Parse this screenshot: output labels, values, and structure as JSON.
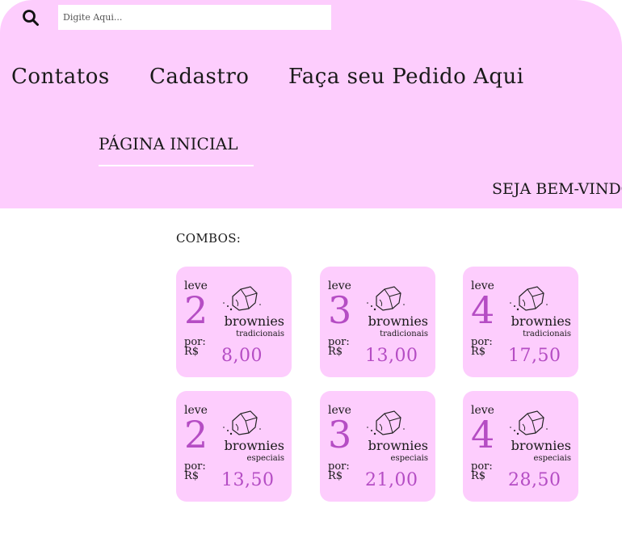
{
  "search": {
    "placeholder": "Digite Aqui..."
  },
  "nav": {
    "items": [
      {
        "label": "Contatos"
      },
      {
        "label": "Cadastro"
      },
      {
        "label": "Faça seu Pedido Aqui"
      }
    ],
    "home": "PÁGINA INICIAL"
  },
  "welcome": "SEJA BEM-VINDO",
  "combos": {
    "title": "COMBOS:",
    "cards": [
      {
        "leve": "leve",
        "qty": "2",
        "item": "brownies",
        "type": "tradicionais",
        "por": "por:",
        "currency": "R$",
        "price": "8,00"
      },
      {
        "leve": "leve",
        "qty": "3",
        "item": "brownies",
        "type": "tradicionais",
        "por": "por:",
        "currency": "R$",
        "price": "13,00"
      },
      {
        "leve": "leve",
        "qty": "4",
        "item": "brownies",
        "type": "tradicionais",
        "por": "por:",
        "currency": "R$",
        "price": "17,50"
      },
      {
        "leve": "leve",
        "qty": "2",
        "item": "brownies",
        "type": "especiais",
        "por": "por:",
        "currency": "R$",
        "price": "13,50"
      },
      {
        "leve": "leve",
        "qty": "3",
        "item": "brownies",
        "type": "especiais",
        "por": "por:",
        "currency": "R$",
        "price": "21,00"
      },
      {
        "leve": "leve",
        "qty": "4",
        "item": "brownies",
        "type": "especiais",
        "por": "por:",
        "currency": "R$",
        "price": "28,50"
      }
    ]
  },
  "colors": {
    "header_bg": "#fdcdfd",
    "accent": "#b54dc4",
    "underline": "#ffffff"
  },
  "icons": {
    "search": "search-icon",
    "card": "brownie-icon"
  }
}
